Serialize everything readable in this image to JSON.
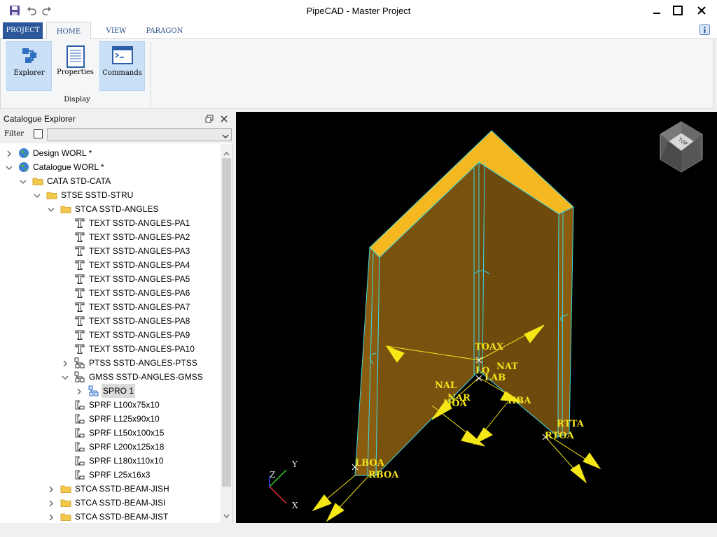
{
  "window": {
    "title": "PipeCAD - Master Project"
  },
  "quick_access": {
    "icons": [
      "save-icon",
      "undo-icon",
      "redo-icon"
    ]
  },
  "ribbon": {
    "tabs": [
      {
        "label": "PROJECT"
      },
      {
        "label": "HOME"
      },
      {
        "label": "VIEW"
      },
      {
        "label": "PARAGON"
      }
    ],
    "active_tab": "HOME",
    "group": {
      "label": "Display",
      "buttons": [
        {
          "label": "Explorer",
          "icon": "explorer-icon",
          "selected": true
        },
        {
          "label": "Properties",
          "icon": "properties-icon",
          "selected": false
        },
        {
          "label": "Commands",
          "icon": "commands-icon",
          "selected": true
        }
      ]
    }
  },
  "explorer": {
    "title": "Catalogue Explorer",
    "filter_label": "Filter",
    "filter_checked": false,
    "filter_value": "",
    "items": [
      {
        "text": "Design WORL *",
        "icon": "globe-icon",
        "expander": "collapsed"
      },
      {
        "text": "Catalogue WORL *",
        "icon": "globe-icon",
        "expander": "expanded"
      },
      {
        "text": "CATA STD-CATA",
        "icon": "folder-icon",
        "expander": "expanded"
      },
      {
        "text": "STSE SSTD-STRU",
        "icon": "folder-icon",
        "expander": "expanded"
      },
      {
        "text": "STCA SSTD-ANGLES",
        "icon": "folder-icon",
        "expander": "expanded"
      },
      {
        "text": "TEXT SSTD-ANGLES-PA1",
        "icon": "text-icon",
        "expander": "none"
      },
      {
        "text": "TEXT SSTD-ANGLES-PA2",
        "icon": "text-icon",
        "expander": "none"
      },
      {
        "text": "TEXT SSTD-ANGLES-PA3",
        "icon": "text-icon",
        "expander": "none"
      },
      {
        "text": "TEXT SSTD-ANGLES-PA4",
        "icon": "text-icon",
        "expander": "none"
      },
      {
        "text": "TEXT SSTD-ANGLES-PA5",
        "icon": "text-icon",
        "expander": "none"
      },
      {
        "text": "TEXT SSTD-ANGLES-PA6",
        "icon": "text-icon",
        "expander": "none"
      },
      {
        "text": "TEXT SSTD-ANGLES-PA7",
        "icon": "text-icon",
        "expander": "none"
      },
      {
        "text": "TEXT SSTD-ANGLES-PA8",
        "icon": "text-icon",
        "expander": "none"
      },
      {
        "text": "TEXT SSTD-ANGLES-PA9",
        "icon": "text-icon",
        "expander": "none"
      },
      {
        "text": "TEXT SSTD-ANGLES-PA10",
        "icon": "text-icon",
        "expander": "none"
      },
      {
        "text": "PTSS SSTD-ANGLES-PTSS",
        "icon": "hierarchy-icon",
        "expander": "collapsed"
      },
      {
        "text": "GMSS SSTD-ANGLES-GMSS",
        "icon": "hierarchy-icon",
        "expander": "expanded"
      },
      {
        "text": "SPRO 1",
        "icon": "hierarchy-blue-icon",
        "expander": "collapsed",
        "selected": true
      },
      {
        "text": "SPRF L100x75x10",
        "icon": "profile-icon",
        "expander": "none"
      },
      {
        "text": "SPRF L125x90x10",
        "icon": "profile-icon",
        "expander": "none"
      },
      {
        "text": "SPRF L150x100x15",
        "icon": "profile-icon",
        "expander": "none"
      },
      {
        "text": "SPRF L200x125x18",
        "icon": "profile-icon",
        "expander": "none"
      },
      {
        "text": "SPRF L180x110x10",
        "icon": "profile-icon",
        "expander": "none"
      },
      {
        "text": "SPRF L25x16x3",
        "icon": "profile-icon",
        "expander": "none"
      },
      {
        "text": "STCA SSTD-BEAM-JISH",
        "icon": "folder-icon",
        "expander": "collapsed"
      },
      {
        "text": "STCA SSTD-BEAM-JISI",
        "icon": "folder-icon",
        "expander": "collapsed"
      },
      {
        "text": "STCA SSTD-BEAM-JIST",
        "icon": "folder-icon",
        "expander": "collapsed"
      }
    ]
  },
  "viewport": {
    "background": "#000000",
    "view_cube_label": "TOP",
    "pline_labels": [
      "TOAX",
      "NAT",
      "LO",
      "LAB",
      "NAL",
      "NAR",
      "HOA",
      "HBA",
      "RTTA",
      "RTOA",
      "LBOA",
      "RBOA"
    ],
    "axis_labels": {
      "x": "X",
      "y": "Y",
      "z": "Z"
    },
    "colors": {
      "face": "#7a520f",
      "top_face": "#f6b820",
      "edge": "#3fd8e0",
      "pline": "#f5e616"
    }
  }
}
